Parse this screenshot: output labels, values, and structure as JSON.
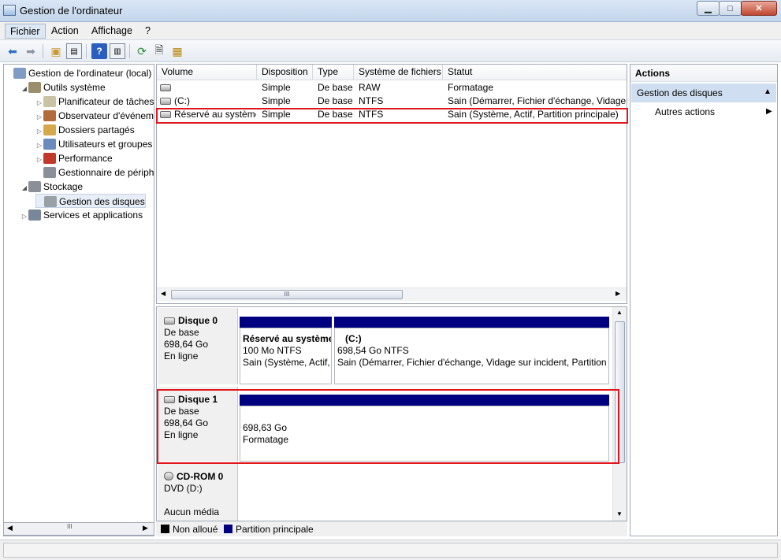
{
  "window": {
    "title": "Gestion de l'ordinateur"
  },
  "menu": {
    "items": [
      "Fichier",
      "Action",
      "Affichage",
      "?"
    ]
  },
  "tree": [
    {
      "label": "Gestion de l'ordinateur (local)",
      "icon": "computer-icon",
      "level": 0,
      "arrow": ""
    },
    {
      "label": "Outils système",
      "icon": "tools-icon",
      "level": 1,
      "arrow": "expanded"
    },
    {
      "label": "Planificateur de tâches",
      "icon": "clock-icon",
      "level": 2,
      "arrow": "collapsed"
    },
    {
      "label": "Observateur d'événements",
      "icon": "event-viewer-icon",
      "level": 2,
      "arrow": "collapsed"
    },
    {
      "label": "Dossiers partagés",
      "icon": "shared-folder-icon",
      "level": 2,
      "arrow": "collapsed"
    },
    {
      "label": "Utilisateurs et groupes locaux",
      "icon": "users-icon",
      "level": 2,
      "arrow": "collapsed"
    },
    {
      "label": "Performance",
      "icon": "performance-icon",
      "level": 2,
      "arrow": "collapsed"
    },
    {
      "label": "Gestionnaire de périphériques",
      "icon": "device-manager-icon",
      "level": 2,
      "arrow": ""
    },
    {
      "label": "Stockage",
      "icon": "storage-icon",
      "level": 1,
      "arrow": "expanded"
    },
    {
      "label": "Gestion des disques",
      "icon": "disk-management-icon",
      "level": 2,
      "arrow": "",
      "selected": true
    },
    {
      "label": "Services et applications",
      "icon": "services-icon",
      "level": 1,
      "arrow": "collapsed"
    }
  ],
  "volumes": {
    "headers": [
      "Volume",
      "Disposition",
      "Type",
      "Système de fichiers",
      "Statut"
    ],
    "rows": [
      {
        "volume": "",
        "disposition": "Simple",
        "type": "De base",
        "fs": "RAW",
        "statut": "Formatage"
      },
      {
        "volume": "(C:)",
        "disposition": "Simple",
        "type": "De base",
        "fs": "NTFS",
        "statut": "Sain (Démarrer, Fichier d'échange, Vidage sur incident, Partition principale)"
      },
      {
        "volume": "Réservé au système",
        "disposition": "Simple",
        "type": "De base",
        "fs": "NTFS",
        "statut": "Sain (Système, Actif, Partition principale)"
      }
    ],
    "scroll_thumb": "III"
  },
  "disks": [
    {
      "name": "Disque 0",
      "type": "De base",
      "size": "698,64 Go",
      "state": "En ligne",
      "partitions": [
        {
          "title": "Réservé au système",
          "size": "100 Mo NTFS",
          "status": "Sain (Système, Actif, Partition principale)"
        },
        {
          "title": "(C:)",
          "size": "698,54 Go NTFS",
          "status": "Sain (Démarrer, Fichier d'échange, Vidage sur incident, Partition principale)"
        }
      ]
    },
    {
      "name": "Disque 1",
      "type": "De base",
      "size": "698,64 Go",
      "state": "En ligne",
      "partitions": [
        {
          "title": "",
          "size": "698,63 Go",
          "status": "Formatage"
        }
      ]
    },
    {
      "name": "CD-ROM 0",
      "type": "DVD (D:)",
      "size": "",
      "state": "Aucun média",
      "partitions": []
    }
  ],
  "legend": [
    {
      "label": "Non alloué",
      "color": "#000000"
    },
    {
      "label": "Partition principale",
      "color": "#000080"
    }
  ],
  "actions": {
    "title": "Actions",
    "section": "Gestion des disques",
    "item": "Autres actions"
  },
  "colors": {
    "partition_bar": "#000080",
    "highlight": "#e1161d",
    "action_section_bg": "#cfdff1"
  }
}
